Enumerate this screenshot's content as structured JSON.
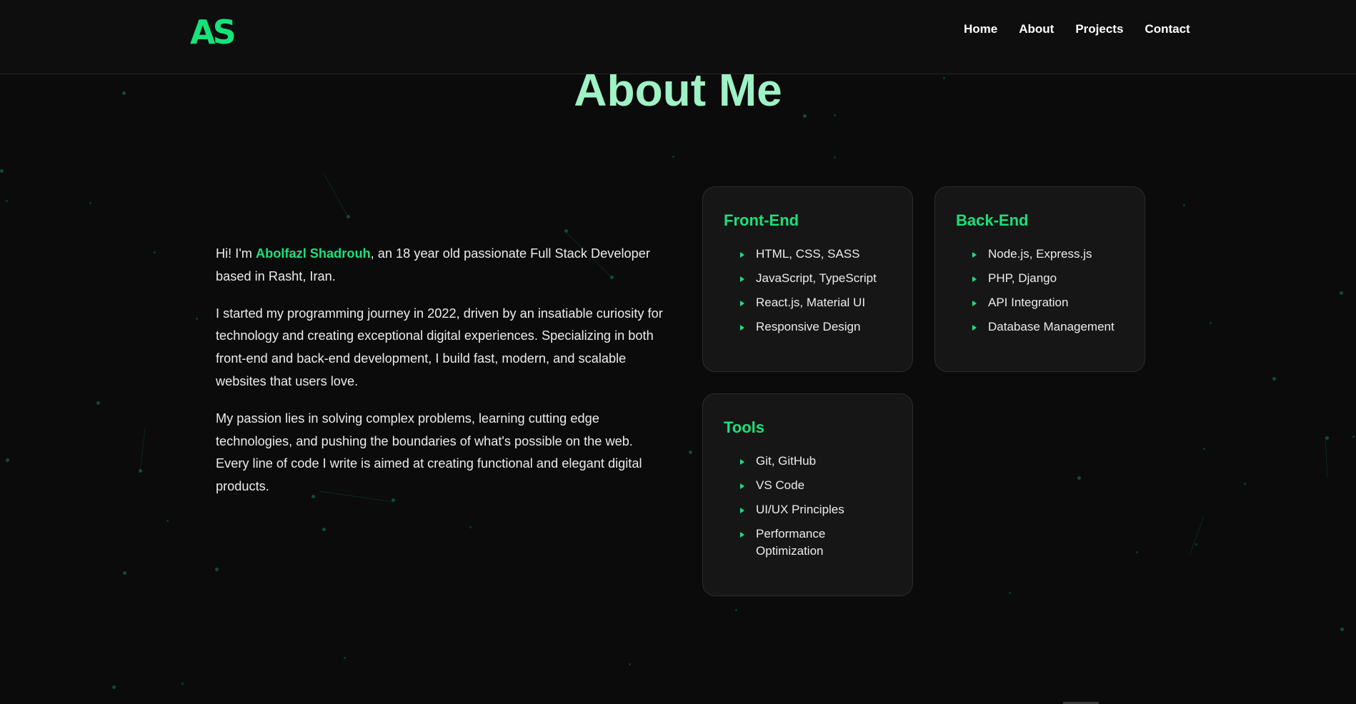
{
  "header": {
    "logo": "AS",
    "nav": [
      "Home",
      "About",
      "Projects",
      "Contact"
    ]
  },
  "section_title": "About Me",
  "bio": {
    "intro_prefix": "Hi! I'm ",
    "name": "Abolfazl Shadrouh",
    "intro_suffix": ", an 18 year old passionate Full Stack Developer based in Rasht, Iran.",
    "paragraph2": "I started my programming journey in 2022, driven by an insatiable curiosity for technology and creating exceptional digital experiences. Specializing in both front-end and back-end development, I build fast, modern, and scalable websites that users love.",
    "paragraph3": "My passion lies in solving complex problems, learning cutting edge technologies, and pushing the boundaries of what's possible on the web. Every line of code I write is aimed at creating functional and elegant digital products."
  },
  "skills": {
    "frontend": {
      "title": "Front-End",
      "items": [
        "HTML, CSS, SASS",
        "JavaScript, TypeScript",
        "React.js, Material UI",
        "Responsive Design"
      ]
    },
    "backend": {
      "title": "Back-End",
      "items": [
        "Node.js, Express.js",
        "PHP, Django",
        "API Integration",
        "Database Management"
      ]
    },
    "tools": {
      "title": "Tools",
      "items": [
        "Git, GitHub",
        "VS Code",
        "UI/UX Principles",
        "Performance Optimization"
      ]
    }
  },
  "colors": {
    "accent": "#1be07b",
    "title": "#9ff2c5",
    "background": "#0b0b0b",
    "card": "#161616"
  }
}
